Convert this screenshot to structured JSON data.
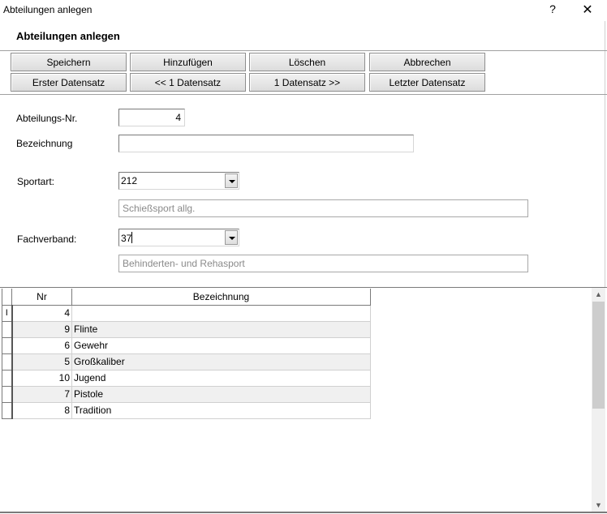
{
  "window": {
    "title": "Abteilungen anlegen",
    "help": "?",
    "close": "✕"
  },
  "heading": "Abteilungen anlegen",
  "buttons": {
    "save": "Speichern",
    "add": "Hinzufügen",
    "delete": "Löschen",
    "cancel": "Abbrechen",
    "first": "Erster Datensatz",
    "prev": "<< 1 Datensatz",
    "next": "1 Datensatz >>",
    "last": "Letzter Datensatz"
  },
  "form": {
    "abteilungs_nr_label": "Abteilungs-Nr.",
    "abteilungs_nr": "4",
    "bezeichnung_label": "Bezeichnung",
    "bezeichnung": "",
    "sportart_label": "Sportart:",
    "sportart": "212",
    "sportart_text": "Schießsport allg.",
    "fachverband_label": "Fachverband:",
    "fachverband": "37",
    "fachverband_text": "Behinderten- und Rehasport"
  },
  "grid": {
    "columns": [
      "Nr",
      "Bezeichnung"
    ],
    "current_row_marker": "I",
    "rows": [
      {
        "nr": "4",
        "bez": ""
      },
      {
        "nr": "9",
        "bez": "Flinte"
      },
      {
        "nr": "6",
        "bez": "Gewehr"
      },
      {
        "nr": "5",
        "bez": "Großkaliber"
      },
      {
        "nr": "10",
        "bez": "Jugend"
      },
      {
        "nr": "7",
        "bez": "Pistole"
      },
      {
        "nr": "8",
        "bez": "Tradition"
      }
    ]
  },
  "scrollbar": {
    "up": "▲",
    "down": "▼"
  }
}
